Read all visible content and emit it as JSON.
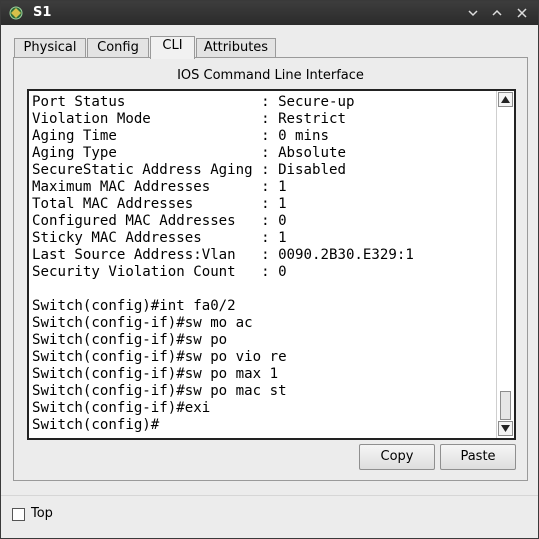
{
  "window": {
    "title": "S1"
  },
  "tabs": [
    {
      "label": "Physical"
    },
    {
      "label": "Config"
    },
    {
      "label": "CLI"
    },
    {
      "label": "Attributes"
    }
  ],
  "cli": {
    "caption": "IOS Command Line Interface",
    "lines": [
      "Port Status                : Secure-up",
      "Violation Mode             : Restrict",
      "Aging Time                 : 0 mins",
      "Aging Type                 : Absolute",
      "SecureStatic Address Aging : Disabled",
      "Maximum MAC Addresses      : 1",
      "Total MAC Addresses        : 1",
      "Configured MAC Addresses   : 0",
      "Sticky MAC Addresses       : 1",
      "Last Source Address:Vlan   : 0090.2B30.E329:1",
      "Security Violation Count   : 0",
      "",
      "Switch(config)#int fa0/2",
      "Switch(config-if)#sw mo ac",
      "Switch(config-if)#sw po",
      "Switch(config-if)#sw po vio re",
      "Switch(config-if)#sw po max 1",
      "Switch(config-if)#sw po mac st",
      "Switch(config-if)#exi",
      "Switch(config)#"
    ]
  },
  "buttons": {
    "copy": "Copy",
    "paste": "Paste"
  },
  "footer": {
    "top_label": "Top",
    "top_checked": false
  },
  "icons": {
    "app": "packet-tracer-icon",
    "minimize": "chevron-down-icon",
    "maximize": "chevron-up-icon",
    "close": "close-icon",
    "scroll_up": "arrow-up-icon",
    "scroll_down": "arrow-down-icon"
  }
}
